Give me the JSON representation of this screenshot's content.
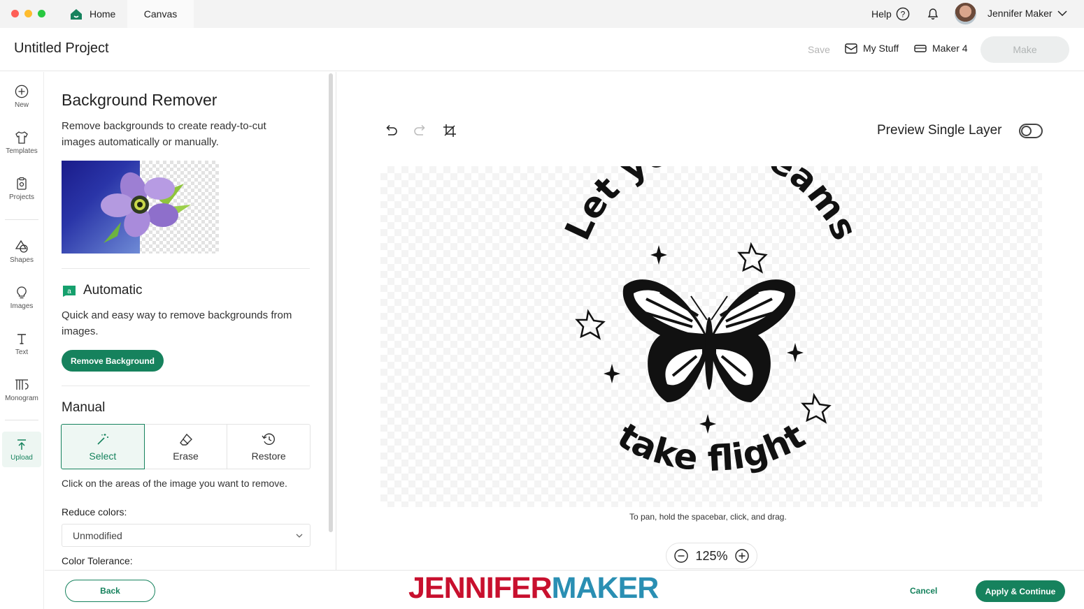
{
  "tabs": {
    "home": "Home",
    "canvas": "Canvas"
  },
  "account": {
    "help": "Help",
    "user_name": "Jennifer Maker"
  },
  "header": {
    "project_title": "Untitled Project",
    "save": "Save",
    "my_stuff": "My Stuff",
    "machine": "Maker 4",
    "make": "Make"
  },
  "rail": {
    "new": "New",
    "templates": "Templates",
    "projects": "Projects",
    "shapes": "Shapes",
    "images": "Images",
    "text": "Text",
    "monogram": "Monogram",
    "upload": "Upload"
  },
  "panel": {
    "title": "Background Remover",
    "description": "Remove backgrounds to create ready-to-cut images automatically or manually.",
    "automatic": {
      "title": "Automatic",
      "description": "Quick and easy way to remove backgrounds from images.",
      "button": "Remove Background"
    },
    "manual": {
      "title": "Manual",
      "tools": {
        "select": "Select",
        "erase": "Erase",
        "restore": "Restore"
      },
      "active_tool": "Select",
      "hint": "Click on the areas of the image you want to remove."
    },
    "reduce_colors": {
      "label": "Reduce colors:",
      "value": "Unmodified"
    },
    "color_tolerance": {
      "label": "Color Tolerance:"
    }
  },
  "canvas": {
    "preview_single_layer": "Preview Single Layer",
    "preview_single_layer_on": false,
    "design": {
      "top_text": "Let your dreams",
      "bottom_text": "take flight"
    },
    "pan_hint": "To pan, hold the spacebar, click, and drag.",
    "zoom": "125%"
  },
  "footer": {
    "back": "Back",
    "cancel": "Cancel",
    "apply": "Apply & Continue"
  },
  "watermark": {
    "part1": "JENNIFER",
    "part2": "MAKER"
  },
  "colors": {
    "accent": "#16825d",
    "watermark_red": "#c8102e",
    "watermark_blue": "#2a8fb3"
  }
}
